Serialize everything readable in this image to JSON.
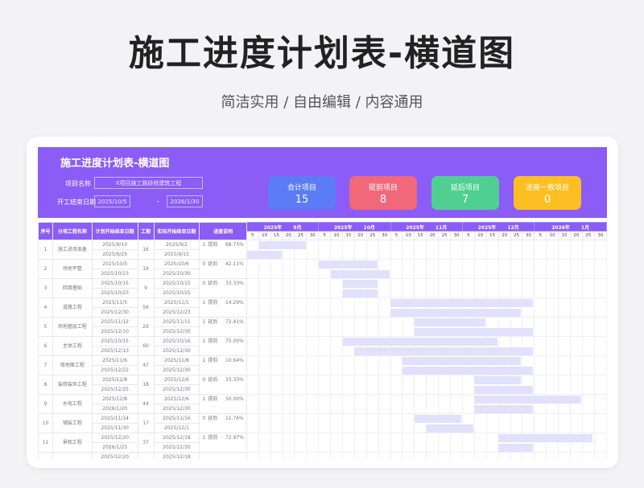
{
  "title": "施工进度计划表-横道图",
  "subtitle": "简洁实用 / 自由编辑 / 内容通用",
  "sheet": {
    "title": "施工进度计划表-横道图",
    "project_label": "项目名称",
    "project_name": "X项目施工路段修建筑工程",
    "dates_label": "开工结束日期",
    "start_date": "2025/10/5",
    "end_date": "2026/1/30",
    "date_sep": "-"
  },
  "stats": [
    {
      "label": "合计项目",
      "value": "15",
      "color": "#5b7cf5"
    },
    {
      "label": "提前项目",
      "value": "8",
      "color": "#f0687a"
    },
    {
      "label": "延后项目",
      "value": "7",
      "color": "#4fcf92"
    },
    {
      "label": "进度一致项目",
      "value": "0",
      "color": "#fbbf24"
    }
  ],
  "columns": [
    "序号",
    "分项工程名称",
    "计划开始结束日期",
    "工期",
    "实际开始结束日期",
    "进度说明"
  ],
  "months": [
    {
      "year": "2025年",
      "month": "9月"
    },
    {
      "year": "2025年",
      "month": "10月"
    },
    {
      "year": "2025年",
      "month": "11月"
    },
    {
      "year": "2025年",
      "month": "12月"
    },
    {
      "year": "2026年",
      "month": "1月"
    }
  ],
  "days": [
    "5",
    "10",
    "15",
    "20",
    "25",
    "30"
  ],
  "colors": {
    "accent": "#8b5cf6",
    "bar": "#e2e1fb"
  },
  "rows": [
    {
      "no": "1",
      "name": "施工进场准备",
      "plan_start": "2025/9/10",
      "plan_end": "2025/9/25",
      "dur": "16",
      "act_start": "2025/9/2",
      "act_end": "2025/9/15",
      "num": "1",
      "status": "提前",
      "pct": "68.75%"
    },
    {
      "no": "2",
      "name": "场地平整",
      "plan_start": "2025/10/5",
      "plan_end": "2025/10/23",
      "dur": "19",
      "act_start": "2025/10/6",
      "act_end": "2025/10/30",
      "num": "0",
      "status": "延后",
      "pct": "42.11%"
    },
    {
      "no": "3",
      "name": "回填基础",
      "plan_start": "2025/10/15",
      "plan_end": "2025/10/23",
      "dur": "9",
      "act_start": "2025/10/15",
      "act_end": "2025/10/25",
      "num": "0",
      "status": "延后",
      "pct": "33.33%"
    },
    {
      "no": "4",
      "name": "道路工程",
      "plan_start": "2025/11/5",
      "plan_end": "2025/12/30",
      "dur": "56",
      "act_start": "2025/11/1",
      "act_end": "2025/12/23",
      "num": "1",
      "status": "提前",
      "pct": "14.29%"
    },
    {
      "no": "5",
      "name": "场地基层工程",
      "plan_start": "2025/11/12",
      "plan_end": "2025/12/10",
      "dur": "29",
      "act_start": "2025/11/11",
      "act_end": "2025/12/30",
      "num": "1",
      "status": "延后",
      "pct": "72.41%"
    },
    {
      "no": "6",
      "name": "主体工程",
      "plan_start": "2025/10/15",
      "plan_end": "2025/12/13",
      "dur": "60",
      "act_start": "2025/10/16",
      "act_end": "2025/12/30",
      "num": "1",
      "status": "提前",
      "pct": "75.00%"
    },
    {
      "no": "7",
      "name": "修地面工程",
      "plan_start": "2025/11/6",
      "plan_end": "2025/12/22",
      "dur": "47",
      "act_start": "2025/11/8",
      "act_end": "2025/12/30",
      "num": "1",
      "status": "提前",
      "pct": "10.64%"
    },
    {
      "no": "8",
      "name": "装修装饰工程",
      "plan_start": "2025/12/8",
      "plan_end": "2025/12/25",
      "dur": "18",
      "act_start": "2025/12/6",
      "act_end": "2025/12/30",
      "num": "0",
      "status": "延后",
      "pct": "33.33%"
    },
    {
      "no": "9",
      "name": "水电工程",
      "plan_start": "2025/12/8",
      "plan_end": "2026/1/20",
      "dur": "44",
      "act_start": "2025/12/6",
      "act_end": "2025/12/30",
      "num": "1",
      "status": "提前",
      "pct": "50.00%"
    },
    {
      "no": "10",
      "name": "铺装工程",
      "plan_start": "2025/11/14",
      "plan_end": "2025/11/30",
      "dur": "17",
      "act_start": "2025/11/16",
      "act_end": "2025/12/1",
      "num": "0",
      "status": "延后",
      "pct": "11.76%"
    },
    {
      "no": "11",
      "name": "景观工程",
      "plan_start": "2025/12/20",
      "plan_end": "2026/1/25",
      "dur": "37",
      "act_start": "2025/12/18",
      "act_end": "2025/12/30",
      "num": "1",
      "status": "提前",
      "pct": "72.97%"
    },
    {
      "no": "",
      "name": "",
      "plan_start": "2025/12/20",
      "plan_end": "",
      "dur": "",
      "act_start": "2025/12/18",
      "act_end": "",
      "num": "",
      "status": "",
      "pct": ""
    }
  ]
}
